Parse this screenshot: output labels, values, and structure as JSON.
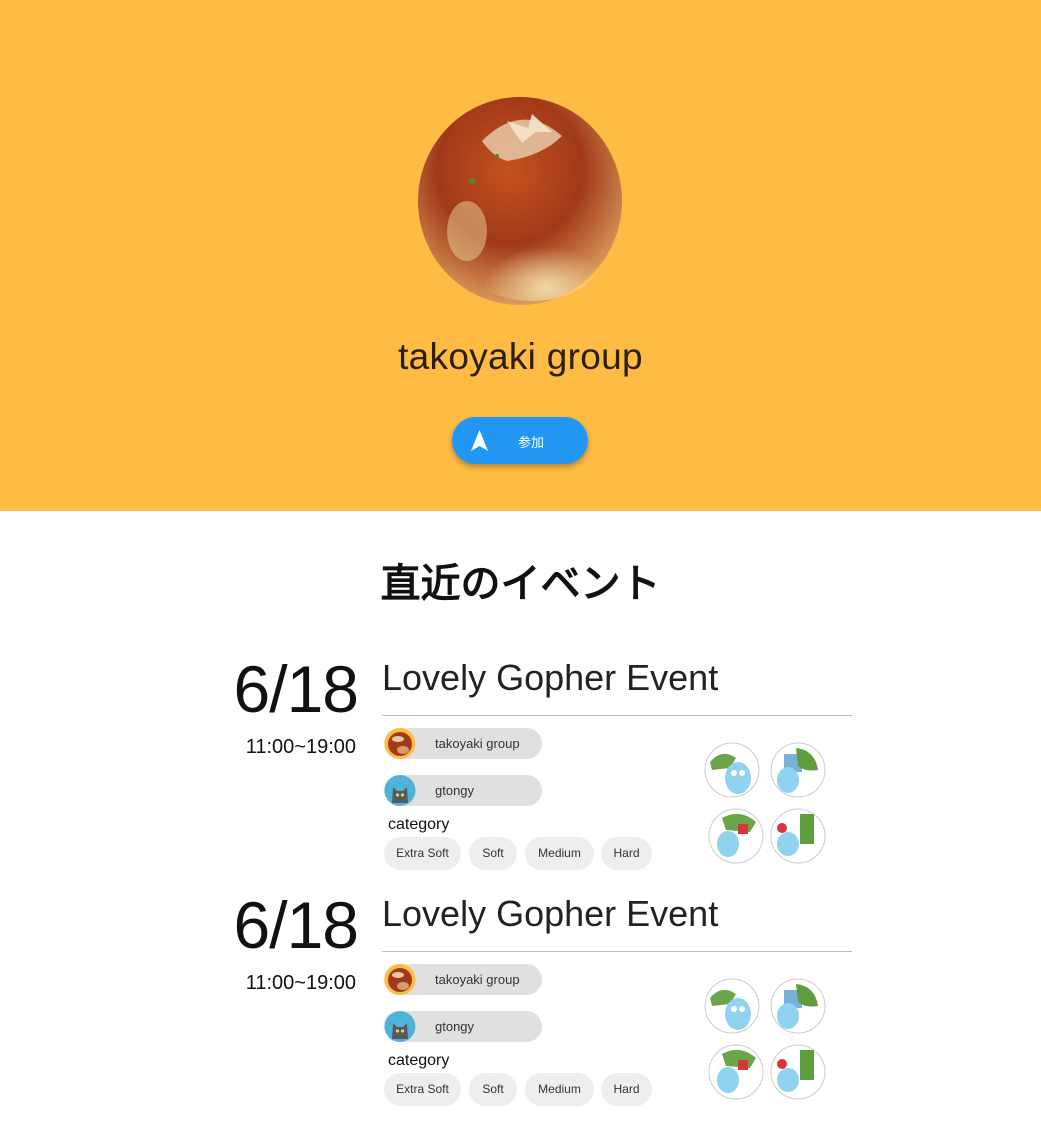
{
  "group": {
    "name": "takoyaki group",
    "join_label": "参加",
    "hero_image": "takoyaki-photo",
    "hero_bg": "#FFBC44"
  },
  "section": {
    "title": "直近のイベント"
  },
  "events": [
    {
      "date": "6/18",
      "time": "11:00~19:00",
      "title": "Lovely Gopher Event",
      "members": [
        {
          "name": "takoyaki group",
          "avatar": "takoyaki-avatar"
        },
        {
          "name": "gtongy",
          "avatar": "cat-avatar"
        }
      ],
      "category_label": "category",
      "categories": [
        "Extra Soft",
        "Soft",
        "Medium",
        "Hard"
      ],
      "image": "gopher-stickers"
    },
    {
      "date": "6/18",
      "time": "11:00~19:00",
      "title": "Lovely Gopher Event",
      "members": [
        {
          "name": "takoyaki group",
          "avatar": "takoyaki-avatar"
        },
        {
          "name": "gtongy",
          "avatar": "cat-avatar"
        }
      ],
      "category_label": "category",
      "categories": [
        "Extra Soft",
        "Soft",
        "Medium",
        "Hard"
      ],
      "image": "gopher-stickers"
    }
  ],
  "colors": {
    "accent": "#2196F3",
    "hero": "#FFBC44",
    "chip": "#e0e0e0"
  }
}
